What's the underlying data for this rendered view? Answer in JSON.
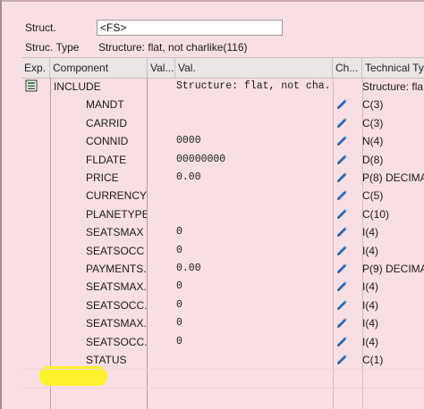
{
  "struct": {
    "label": "Struct.",
    "value": "<FS>"
  },
  "struc_type": {
    "label": "Struc. Type",
    "value": "Structure: flat, not charlike(116)"
  },
  "columns": {
    "exp": "Exp.",
    "component": "Component",
    "val_short": "Val...",
    "val": "Val.",
    "change": "Ch...",
    "technical_type": "Technical Ty"
  },
  "rows": [
    {
      "component": "INCLUDE",
      "val": "Structure: flat, not cha...",
      "type": "Structure: fla",
      "include": true,
      "editable": false
    },
    {
      "component": "MANDT",
      "val": "",
      "type": "C(3)",
      "editable": true
    },
    {
      "component": "CARRID",
      "val": "",
      "type": "C(3)",
      "editable": true
    },
    {
      "component": "CONNID",
      "val": "0000",
      "type": "N(4)",
      "editable": true
    },
    {
      "component": "FLDATE",
      "val": "00000000",
      "type": "D(8)",
      "editable": true
    },
    {
      "component": "PRICE",
      "val": "0.00",
      "type": "P(8) DECIMA",
      "editable": true
    },
    {
      "component": "CURRENCY",
      "val": "",
      "type": "C(5)",
      "editable": true
    },
    {
      "component": "PLANETYPE",
      "val": "",
      "type": "C(10)",
      "editable": true
    },
    {
      "component": "SEATSMAX",
      "val": "0",
      "type": "I(4)",
      "editable": true
    },
    {
      "component": "SEATSOCC",
      "val": "0",
      "type": "I(4)",
      "editable": true
    },
    {
      "component": "PAYMENTS...",
      "val": "0.00",
      "type": "P(9) DECIMA",
      "editable": true
    },
    {
      "component": "SEATSMAX...",
      "val": "0",
      "type": "I(4)",
      "editable": true
    },
    {
      "component": "SEATSOCC...",
      "val": "0",
      "type": "I(4)",
      "editable": true
    },
    {
      "component": "SEATSMAX...",
      "val": "0",
      "type": "I(4)",
      "editable": true
    },
    {
      "component": "SEATSOCC...",
      "val": "0",
      "type": "I(4)",
      "editable": true
    },
    {
      "component": "STATUS",
      "val": "",
      "type": "C(1)",
      "editable": true,
      "status": true
    }
  ],
  "colors": {
    "background": "#f8dfe3",
    "header": "#ece5e6",
    "highlight": "#fff12e",
    "pencil": "#2a6ab8"
  },
  "icons": {
    "include": "structure-include-icon",
    "edit": "pencil-icon"
  }
}
